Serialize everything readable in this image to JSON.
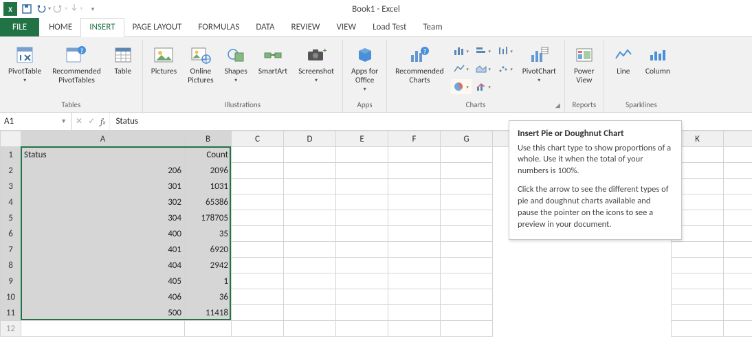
{
  "window": {
    "title": "Book1 - Excel"
  },
  "qat": {
    "excel": "X"
  },
  "tabs": {
    "file": "FILE",
    "items": [
      "HOME",
      "INSERT",
      "PAGE LAYOUT",
      "FORMULAS",
      "DATA",
      "REVIEW",
      "VIEW",
      "Load Test",
      "Team"
    ],
    "active_index": 1
  },
  "ribbon": {
    "tables": {
      "caption": "Tables",
      "pivot": "PivotTable",
      "recpivot": "Recommended\nPivotTables",
      "table": "Table"
    },
    "illus": {
      "caption": "Illustrations",
      "pics": "Pictures",
      "online": "Online\nPictures",
      "shapes": "Shapes",
      "smart": "SmartArt",
      "screenshot": "Screenshot"
    },
    "apps": {
      "caption": "Apps",
      "apps": "Apps for\nOffice "
    },
    "charts": {
      "caption": "Charts",
      "rec": "Recommended\nCharts",
      "pivotchart": "PivotChart"
    },
    "reports": {
      "caption": "Reports",
      "power": "Power\nView"
    },
    "spark": {
      "caption": "Sparklines",
      "line": "Line",
      "col": "Column"
    }
  },
  "formula_bar": {
    "name_box": "A1",
    "formula": "Status"
  },
  "columns": [
    "A",
    "B",
    "C",
    "D",
    "E",
    "F",
    "G",
    "K"
  ],
  "row_headers": [
    1,
    2,
    3,
    4,
    5,
    6,
    7,
    8,
    9,
    10,
    11
  ],
  "table": {
    "headers": {
      "a": "Status",
      "b": "Count"
    },
    "rows": [
      {
        "a": "206",
        "b": "2096"
      },
      {
        "a": "301",
        "b": "1031"
      },
      {
        "a": "302",
        "b": "65386"
      },
      {
        "a": "304",
        "b": "178705"
      },
      {
        "a": "400",
        "b": "35"
      },
      {
        "a": "401",
        "b": "6920"
      },
      {
        "a": "404",
        "b": "2942"
      },
      {
        "a": "405",
        "b": "1"
      },
      {
        "a": "406",
        "b": "36"
      },
      {
        "a": "500",
        "b": "11418"
      }
    ]
  },
  "tooltip": {
    "title": "Insert Pie or Doughnut Chart",
    "p1": "Use this chart type to show proportions of a whole. Use it when the total of your numbers is 100%.",
    "p2": "Click the arrow to see the different types of pie and doughnut charts available and pause the pointer on the icons to see a preview in your document."
  }
}
